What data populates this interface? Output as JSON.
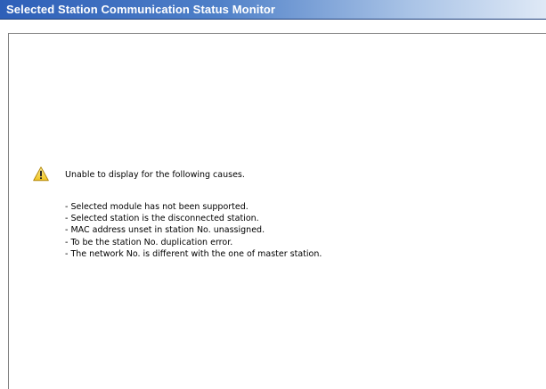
{
  "window": {
    "title": "Selected Station Communication Status Monitor"
  },
  "message": {
    "icon": "warning-icon",
    "heading": "Unable to display for the following causes.",
    "causes": [
      "- Selected module has not been supported.",
      "- Selected station is the disconnected station.",
      "- MAC address unset in station No. unassigned.",
      "- To be the station No. duplication error.",
      "- The network No. is different with the one of master station."
    ]
  },
  "colors": {
    "title_bar_start": "#2e5fb8",
    "title_bar_end": "#dfe9f6",
    "title_text": "#ffffff",
    "warning_fill": "#f5d33a"
  }
}
